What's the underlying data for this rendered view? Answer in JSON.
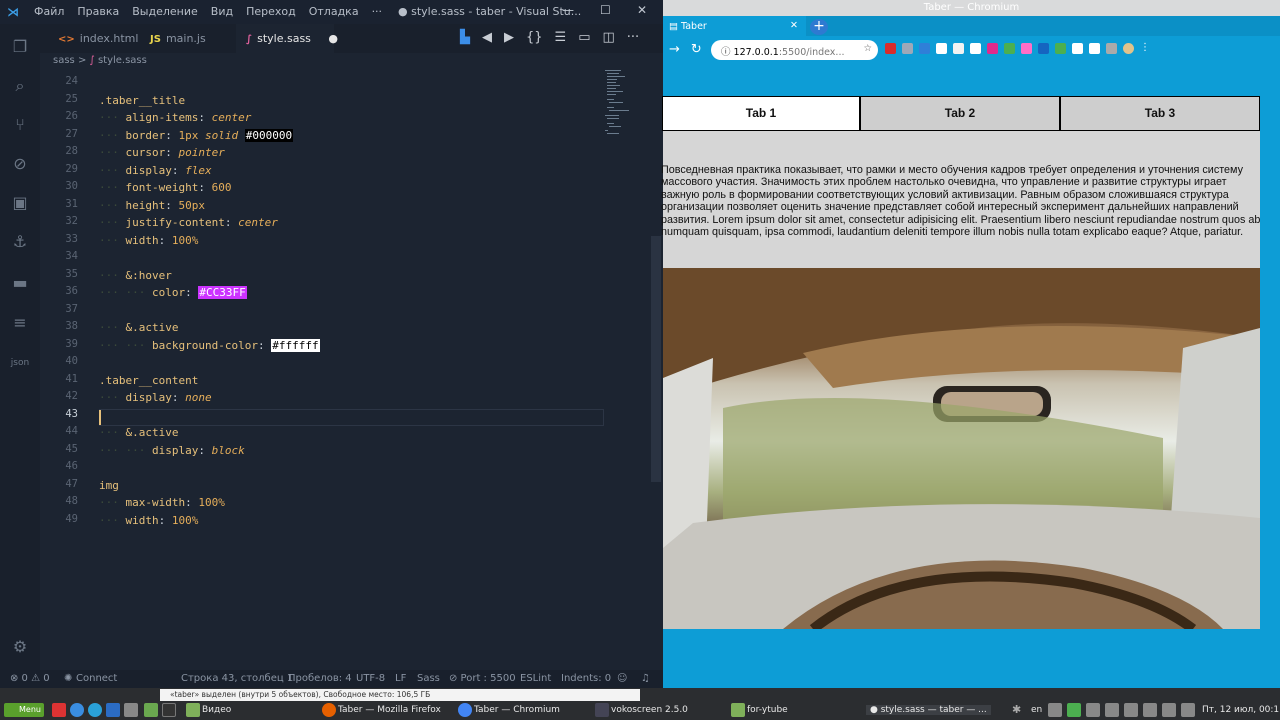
{
  "vscode": {
    "menu": [
      "Файл",
      "Правка",
      "Выделение",
      "Вид",
      "Переход",
      "Отладка",
      "···"
    ],
    "window_title": "● style.sass - taber - Visual Stu...",
    "tabs": [
      {
        "icon": "<>",
        "label": "index.html"
      },
      {
        "icon": "JS",
        "label": "main.js"
      },
      {
        "icon": "∫",
        "label": "style.sass",
        "active": true
      }
    ],
    "breadcrumb": [
      "sass",
      ">",
      "style.sass"
    ],
    "line_numbers": [
      "24",
      "25",
      "26",
      "27",
      "28",
      "29",
      "30",
      "31",
      "32",
      "33",
      "34",
      "35",
      "36",
      "37",
      "38",
      "39",
      "40",
      "41",
      "42",
      "43",
      "44",
      "45",
      "46",
      "47",
      "48",
      "49"
    ],
    "code": {
      "l25": ".taber__title",
      "l26p": "align-items",
      "l26v": "center",
      "l27p": "border",
      "l27a": "1px",
      "l27b": "solid",
      "l27c": "#000000",
      "l28p": "cursor",
      "l28v": "pointer",
      "l29p": "display",
      "l29v": "flex",
      "l30p": "font-weight",
      "l30v": "600",
      "l31p": "height",
      "l31v": "50px",
      "l32p": "justify-content",
      "l32v": "center",
      "l33p": "width",
      "l33v": "100%",
      "l35": "&:hover",
      "l36p": "color",
      "l36v": "#CC33FF",
      "l38": "&.active",
      "l39p": "background-color",
      "l39v": "#ffffff",
      "l41": ".taber__content",
      "l42p": "display",
      "l42v": "none",
      "l44": "&.active",
      "l45p": "display",
      "l45v": "block",
      "l47": "img",
      "l48p": "max-width",
      "l48v": "100%",
      "l49p": "width",
      "l49v": "100%"
    },
    "status": {
      "errors": "⊗ 0 ⚠ 0",
      "connect": "Connect",
      "position": "Строка 43, столбец 1",
      "spaces": "Пробелов: 4",
      "encoding": "UTF-8",
      "eol": "LF",
      "language": "Sass",
      "port": "⊘ Port : 5500",
      "eslint": "ESLint",
      "indents": "Indents: 0"
    }
  },
  "chromium": {
    "window_title": "Taber — Chromium",
    "tab_title": "Taber",
    "url_host": "127.0.0.1",
    "url_path": ":5500/index...",
    "page": {
      "tabs": [
        "Tab 1",
        "Tab 2",
        "Tab 3"
      ],
      "paragraph": "Повседневная практика показывает, что рамки и место обучения кадров требует определения и уточнения систему массового участия. Значимость этих проблем настолько очевидна, что управление и развитие структуры играет важную роль в формировании соответствующих условий активизации. Равным образом сложившаяся структура организации позволяет оценить значение представляет собой интересный эксперимент дальнейших направлений развития. Lorem ipsum dolor sit amet, consectetur adipisicing elit. Praesentium libero nesciunt repudiandae nostrum quos ab numquam quisquam, ipsa commodi, laudantium deleniti tempore illum nobis nulla totam explicabo eaque? Atque, pariatur."
    }
  },
  "taskbar": {
    "menu": "Menu",
    "hint": "«taber» выделен (внутри 5 объектов), Свободное место: 106,5 ГБ",
    "items": [
      "Видео",
      "Taber — Mozilla Firefox",
      "Taber — Chromium",
      "vokoscreen 2.5.0",
      "for-ytube",
      "● style.sass — taber — ..."
    ],
    "lang": "en",
    "clock": "Пт, 12 июл, 00:1"
  },
  "colors": {
    "vscode_bg": "#1c2431",
    "chrome_accent": "#0d9dd6",
    "hover_swatch": "#CC33FF"
  }
}
